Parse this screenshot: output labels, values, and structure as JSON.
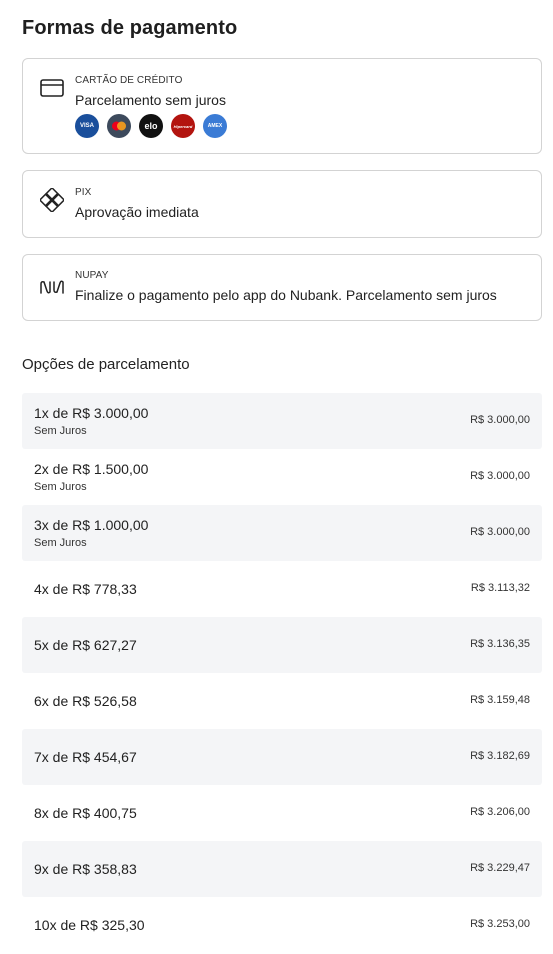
{
  "header": {
    "title": "Formas de pagamento"
  },
  "methods": [
    {
      "small": "CARTÃO DE CRÉDITO",
      "main": "Parcelamento sem juros",
      "icon": "credit-card-icon"
    },
    {
      "small": "PIX",
      "main": "Aprovação imediata",
      "icon": "pix-icon"
    },
    {
      "small": "NUPAY",
      "main": "Finalize o pagamento pelo app do Nubank. Parcelamento sem juros",
      "icon": "nupay-icon"
    }
  ],
  "brands": [
    {
      "name": "visa-logo",
      "label": "VISA",
      "color": "#1a4f9c"
    },
    {
      "name": "mastercard-logo",
      "label": "",
      "color": "#3d4a5c"
    },
    {
      "name": "elo-logo",
      "label": "elo",
      "color": "#111111"
    },
    {
      "name": "hipercard-logo",
      "label": "Hipercard",
      "color": "#b3140f"
    },
    {
      "name": "amex-logo",
      "label": "AMEX",
      "color": "#3a7bd5"
    }
  ],
  "installments": {
    "title": "Opções de parcelamento",
    "options": [
      {
        "label": "1x de R$ 3.000,00",
        "sub": "Sem Juros",
        "total": "R$ 3.000,00"
      },
      {
        "label": "2x de R$ 1.500,00",
        "sub": "Sem Juros",
        "total": "R$ 3.000,00"
      },
      {
        "label": "3x de R$ 1.000,00",
        "sub": "Sem Juros",
        "total": "R$ 3.000,00"
      },
      {
        "label": "4x de R$ 778,33",
        "sub": "",
        "total": "R$ 3.113,32"
      },
      {
        "label": "5x de R$ 627,27",
        "sub": "",
        "total": "R$ 3.136,35"
      },
      {
        "label": "6x de R$ 526,58",
        "sub": "",
        "total": "R$ 3.159,48"
      },
      {
        "label": "7x de R$ 454,67",
        "sub": "",
        "total": "R$ 3.182,69"
      },
      {
        "label": "8x de R$ 400,75",
        "sub": "",
        "total": "R$ 3.206,00"
      },
      {
        "label": "9x de R$ 358,83",
        "sub": "",
        "total": "R$ 3.229,47"
      },
      {
        "label": "10x de R$ 325,30",
        "sub": "",
        "total": "R$ 3.253,00"
      }
    ]
  }
}
